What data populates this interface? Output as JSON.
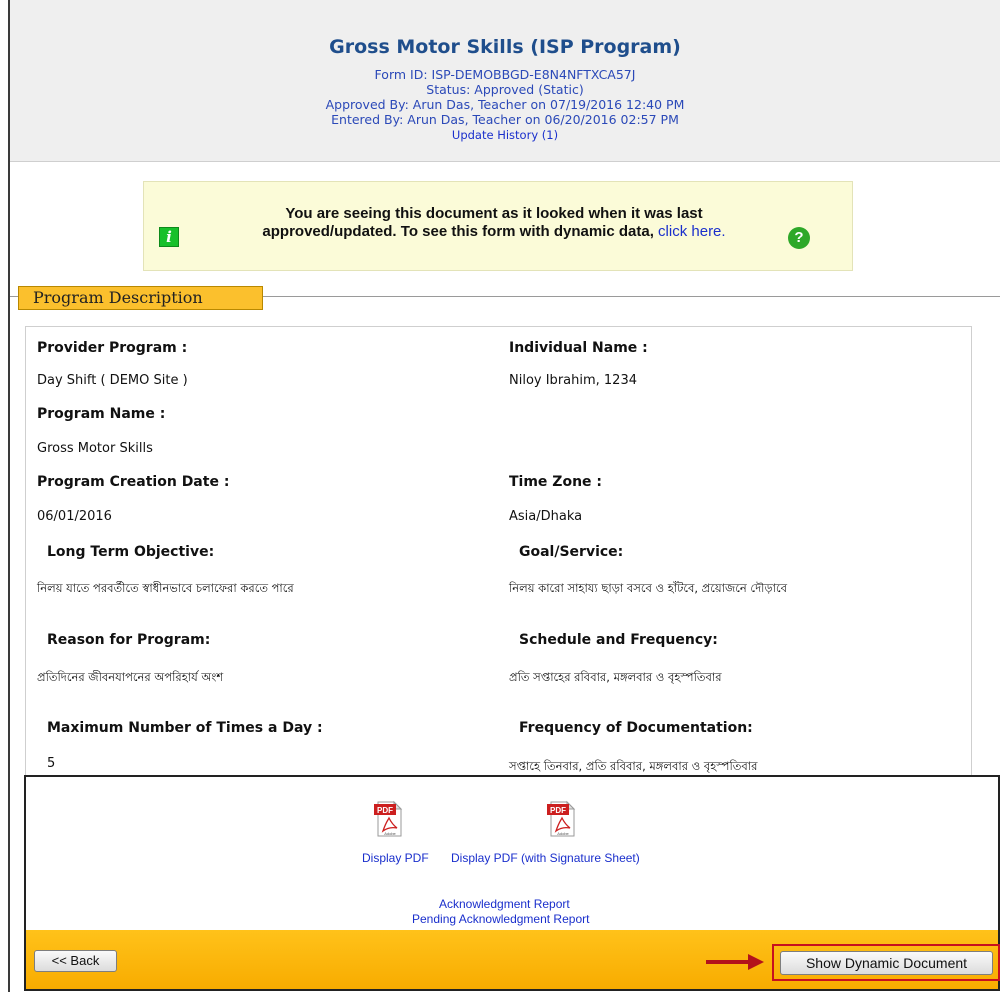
{
  "header": {
    "title": "Gross Motor Skills (ISP Program)",
    "form_id": "Form ID: ISP-DEMOBBGD-E8N4NFTXCA57J",
    "status": "Status:  Approved (Static)",
    "approved_by": "Approved By: Arun Das, Teacher on 07/19/2016 12:40 PM",
    "entered_by": "Entered By: Arun Das, Teacher  on 06/20/2016 02:57 PM",
    "update_history": "Update History  (1)"
  },
  "notice": {
    "line1": "You are seeing this document as it looked when it was last",
    "line2": "approved/updated. To see this form with dynamic data,",
    "link": "click here.",
    "info_icon": "i",
    "help_icon": "?"
  },
  "section": {
    "title": "Program Description"
  },
  "fields": {
    "provider_program_label": "Provider Program :",
    "provider_program_value": "Day Shift ( DEMO Site )",
    "individual_name_label": "Individual Name :",
    "individual_name_value": "Niloy Ibrahim, 1234",
    "program_name_label": "Program Name :",
    "program_name_value": "Gross Motor Skills",
    "creation_date_label": "Program Creation Date :",
    "creation_date_value": "06/01/2016",
    "time_zone_label": "Time Zone :",
    "time_zone_value": "Asia/Dhaka",
    "long_term_label": "Long Term Objective:",
    "long_term_value": "নিলয় যাতে পরবর্তীতে স্বাধীনভাবে চলাফেরা করতে পারে",
    "goal_label": "Goal/Service:",
    "goal_value": "নিলয় কারো সাহায্য ছাড়া বসবে ও হাঁটবে, প্রয়োজনে দৌড়াবে",
    "reason_label": "Reason for Program:",
    "reason_value": "প্রতিদিনের জীবনযাপনের অপরিহার্য অংশ",
    "schedule_label": "Schedule and Frequency:",
    "schedule_value": "প্রতি সপ্তাহের রবিবার, মঙ্গলবার ও বৃহস্পতিবার",
    "max_times_label": "Maximum Number of Times a Day :",
    "max_times_value": "5",
    "doc_freq_label": "Frequency of Documentation:",
    "doc_freq_value": "সপ্তাহে তিনবার, প্রতি রবিবার, মঙ্গলবার ও বৃহস্পতিবার"
  },
  "bottom": {
    "display_pdf": "Display PDF",
    "display_pdf_sig": "Display PDF (with Signature Sheet)",
    "ack_report": "Acknowledgment Report",
    "pending_ack_report": "Pending Acknowledgment Report",
    "pdf_badge": "PDF",
    "pdf_sub": "Adobe",
    "back_button": "<< Back",
    "show_dynamic_button": "Show Dynamic Document"
  }
}
